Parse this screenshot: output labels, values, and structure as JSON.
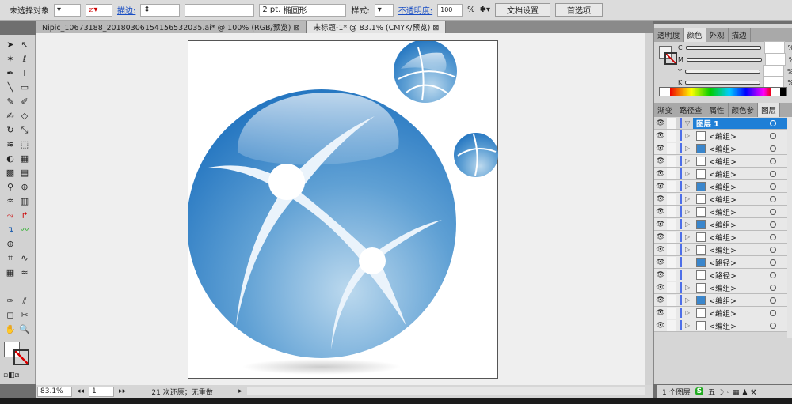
{
  "control_bar": {
    "selection": "未选择对象",
    "stroke_label": "描边:",
    "stroke_width": "2 pt.",
    "brush": "椭圆形",
    "style_label": "样式:",
    "opacity_label": "不透明度:",
    "opacity_value": "100",
    "percent": "%",
    "doc_setup": "文档设置",
    "preferences": "首选项"
  },
  "tabs": [
    {
      "label": "Nipic_10673188_20180306154156532035.ai* @ 100% (RGB/预览)",
      "active": false
    },
    {
      "label": "未标题-1* @ 83.1% (CMYK/预览)",
      "active": true
    }
  ],
  "color_panel": {
    "tabs": [
      "透明度",
      "颜色",
      "外观",
      "描边"
    ],
    "channels": [
      "C",
      "M",
      "Y",
      "K"
    ],
    "percent": "%"
  },
  "layers_panel": {
    "tabs": [
      "渐变",
      "路径查",
      "属性",
      "颜色参",
      "图层"
    ],
    "layer": "图层 1",
    "items": [
      "<编组>",
      "<编组>",
      "<编组>",
      "<编组>",
      "<编组>",
      "<编组>",
      "<编组>",
      "<编组>",
      "<编组>",
      "<编组>",
      "<路径>",
      "<路径>",
      "<编组>",
      "<编组>",
      "<编组>",
      "<编组>"
    ],
    "count": "1 个图层"
  },
  "status": {
    "zoom": "83.1%",
    "artboard": "1",
    "history": "21 次还原；无重做"
  },
  "colors": {
    "accent": "#1f7fd6",
    "globe": "#2a7fc6"
  }
}
